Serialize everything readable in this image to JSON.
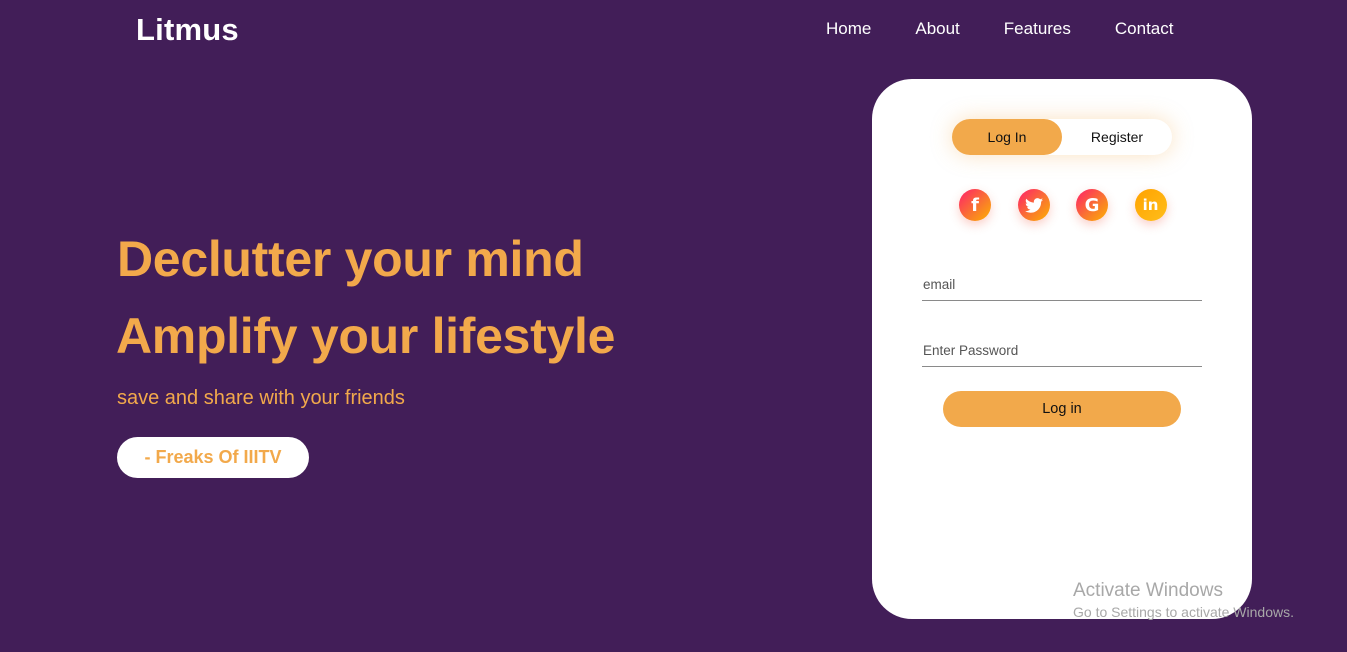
{
  "brand": {
    "name": "Litmus"
  },
  "nav": {
    "items": [
      "Home",
      "About",
      "Features",
      "Contact"
    ]
  },
  "hero": {
    "line1": "Declutter your mind",
    "line2": "Amplify your lifestyle",
    "subtitle": "save and share with your friends",
    "tag": "- Freaks Of IIITV"
  },
  "auth": {
    "tabs": {
      "login": "Log In",
      "register": "Register",
      "active": "login"
    },
    "socials": [
      {
        "name": "facebook",
        "glyph": "f"
      },
      {
        "name": "twitter",
        "glyph": "t"
      },
      {
        "name": "google",
        "glyph": "G"
      },
      {
        "name": "linkedin",
        "glyph": "in"
      }
    ],
    "email_placeholder": "email",
    "password_placeholder": "Enter Password",
    "submit_label": "Log in"
  },
  "watermark": {
    "title": "Activate Windows",
    "subtitle": "Go to Settings to activate Windows."
  },
  "colors": {
    "background": "#421e58",
    "accent": "#f2a94b",
    "card": "#ffffff"
  }
}
